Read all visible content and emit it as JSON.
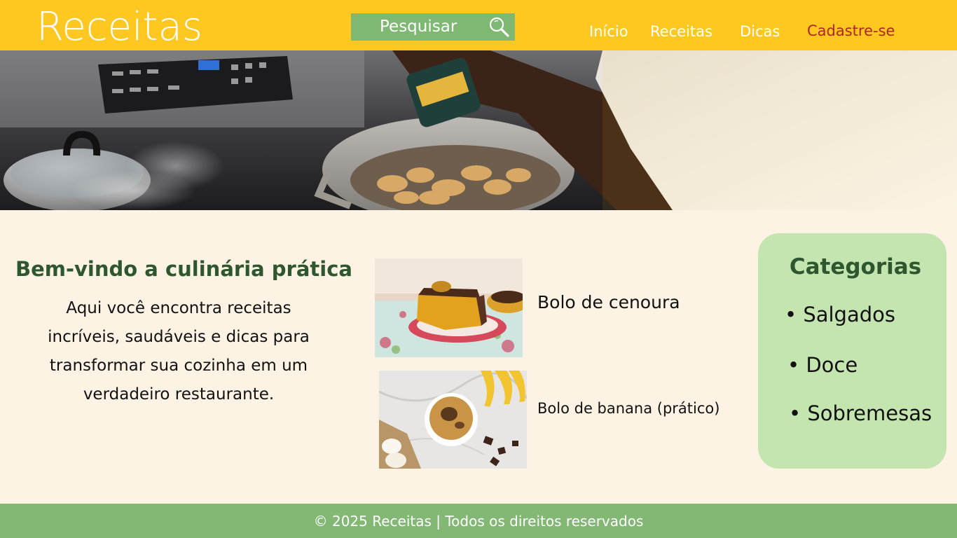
{
  "header": {
    "logo": "Receitas",
    "search_label": "Pesquisar",
    "search_icon": "magnifier-icon",
    "nav": {
      "home": "Início",
      "recipes": "Receitas",
      "tips": "Dicas",
      "signup": "Cadastre-se"
    }
  },
  "welcome": {
    "title": "Bem-vindo a culinária prática",
    "lines": [
      "Aqui você encontra receitas",
      "incríveis, saudáveis e dicas para",
      "transformar sua cozinha em um",
      "verdadeiro restaurante."
    ]
  },
  "recipes": [
    {
      "label": "Bolo de cenoura"
    },
    {
      "label": "Bolo de banana (prático)"
    }
  ],
  "categories": {
    "title": "Categorias",
    "items": [
      "• Salgados",
      "• Doce",
      "• Sobremesas"
    ]
  },
  "footer": {
    "text": "© 2025 Receitas | Todos os direitos reservados"
  },
  "colors": {
    "header": "#fec821",
    "search": "#7fb873",
    "accent_green": "#2e5730",
    "signup": "#b0261a",
    "categories_bg": "#c5e5b0",
    "footer": "#82b873",
    "page_bg": "#fdf3e4"
  }
}
